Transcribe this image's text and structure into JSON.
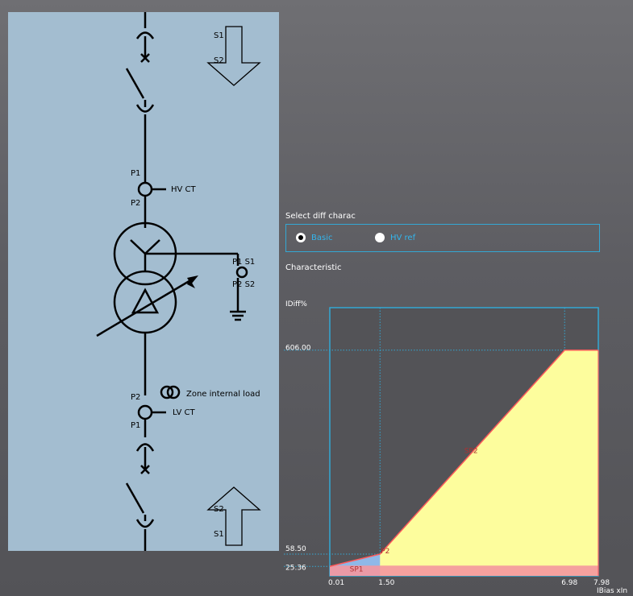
{
  "diagram": {
    "hv_arrow_top": "S1",
    "hv_arrow_bottom": "S2",
    "hv_ct_p1": "P1",
    "hv_ct_p2": "P2",
    "hv_ct_label": "HV CT",
    "ref_ct_p1s1": "P1 S1",
    "ref_ct_p2s2": "P2 S2",
    "lv_ct_p2": "P2",
    "lv_ct_p1": "P1",
    "zone_load_label": "Zone internal load",
    "lv_ct_label": "LV CT",
    "lv_arrow_top": "S2",
    "lv_arrow_bottom": "S1"
  },
  "select": {
    "title": "Select diff charac",
    "options": [
      {
        "label": "Basic",
        "selected": true
      },
      {
        "label": "HV ref",
        "selected": false
      }
    ]
  },
  "characteristic_label": "Characteristic",
  "chart_data": {
    "type": "area",
    "ylabel": "IDiff%",
    "xlabel": "IBias xIn",
    "x_ticks": [
      "0.01",
      "1.50",
      "6.98",
      "7.98"
    ],
    "y_ticks": [
      "606.00",
      "58.50",
      "25.36"
    ],
    "xlim": [
      0.01,
      7.98
    ],
    "ylim": [
      0,
      720
    ],
    "points": [
      {
        "x": 0.01,
        "y": 25.36
      },
      {
        "x": 1.5,
        "y": 58.5
      },
      {
        "x": 6.98,
        "y": 606.0
      },
      {
        "x": 7.98,
        "y": 606.0
      }
    ],
    "annotations": [
      "SP1",
      "SP2",
      "P2"
    ],
    "colors": {
      "trip_area": "#fdfd9d",
      "curve": "#ff5a5a",
      "band": "#f4979f",
      "sp1_area": "#8fb8e8",
      "axis": "#33a8d4",
      "grid": "#33a8d4",
      "plot_bg": "#535357"
    }
  }
}
